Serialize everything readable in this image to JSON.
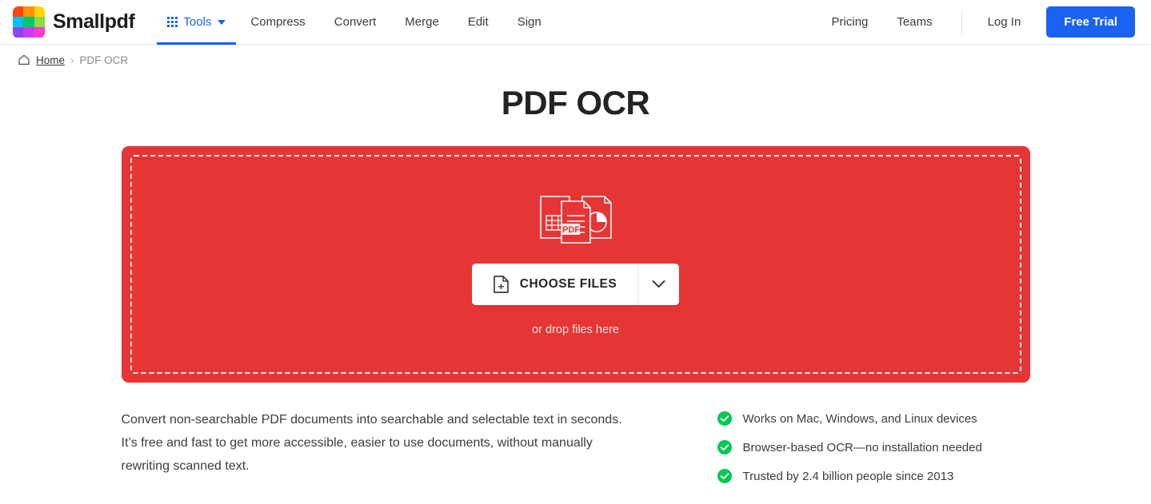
{
  "header": {
    "brand_name": "Smallpdf",
    "logo_colors": [
      "#FA4616",
      "#FF9100",
      "#FFD500",
      "#00C2F0",
      "#00C66B",
      "#8BDC3C",
      "#8C45F0",
      "#CC3AF5",
      "#FF3ACB"
    ],
    "tools_label": "Tools",
    "nav_links": [
      "Compress",
      "Convert",
      "Merge",
      "Edit",
      "Sign"
    ],
    "right_links": [
      "Pricing",
      "Teams"
    ],
    "login_label": "Log In",
    "free_trial_label": "Free Trial",
    "accent_blue": "#1a62ef"
  },
  "breadcrumb": {
    "home_label": "Home",
    "separator": "›",
    "current": "PDF OCR"
  },
  "page": {
    "title": "PDF OCR"
  },
  "dropzone": {
    "background_color": "#E53535",
    "pdf_badge": "PDF",
    "choose_files_label": "CHOOSE FILES",
    "drop_hint": "or drop files here"
  },
  "bottom": {
    "description": "Convert non-searchable PDF documents into searchable and selectable text in seconds. It’s free and fast to get more accessible, easier to use documents, without manually rewriting scanned text.",
    "check_color": "#00C853",
    "features": [
      "Works on Mac, Windows, and Linux devices",
      "Browser-based OCR—no installation needed",
      "Trusted by 2.4 billion people since 2013"
    ]
  }
}
